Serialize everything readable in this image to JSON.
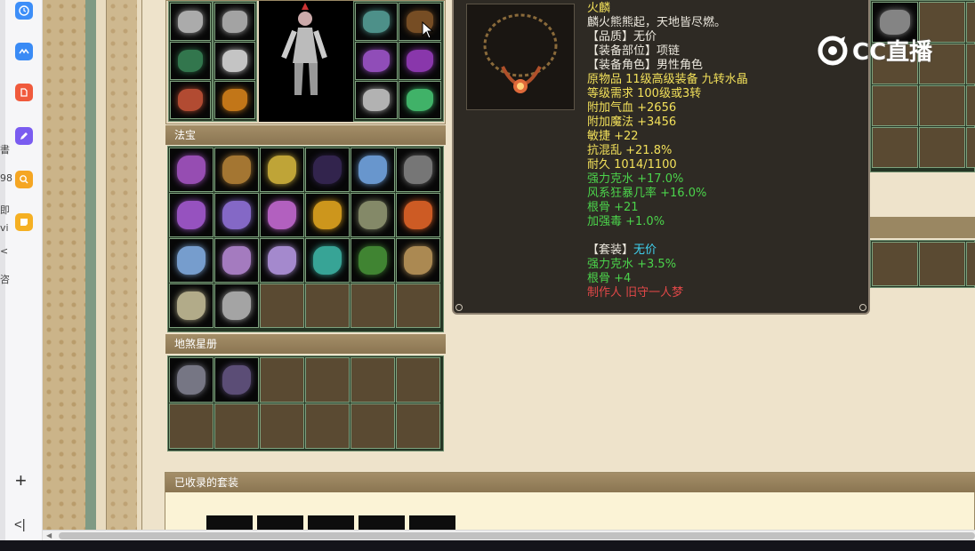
{
  "dock": {
    "apps": [
      {
        "icon": "clock-icon",
        "color": "#3d8ef8"
      },
      {
        "icon": "wave-icon",
        "color": "#3a8bf5"
      },
      {
        "icon": "document-icon",
        "color": "#f05a3c"
      },
      {
        "icon": "pencil-icon",
        "color": "#7a5cf0"
      },
      {
        "icon": "search-icon",
        "color": "#f5a623"
      },
      {
        "icon": "note-icon",
        "color": "#f5b023"
      }
    ],
    "peek_texts": [
      "書",
      "98",
      "即",
      "vi",
      "<",
      "咨"
    ],
    "add_label": "+",
    "collapse_label": "<|"
  },
  "sections": {
    "fabao_title": "法宝",
    "disha_title": "地煞星册",
    "suits_title": "已收录的套装"
  },
  "tooltip": {
    "item_name": "火麟",
    "flavor": "麟火熊熊起，天地皆尽燃。",
    "quality_label": "【品质】",
    "quality_value": "无价",
    "slot_line": "【装备部位】项链",
    "role_line": "【装备角色】男性角色",
    "origin_line": "原物品 11级高级装备 九转水晶",
    "level_line": "等级需求 100级或3转",
    "hp_line": "附加气血 +2656",
    "mp_line": "附加魔法 +3456",
    "agility_line": "敏捷 +22",
    "chaos_line": "抗混乱 +21.8%",
    "durability_line": "耐久 1014/1100",
    "green_lines": [
      "强力克水 +17.0%",
      "风系狂暴几率 +16.0%",
      "根骨 +21",
      "加强毒 +1.0%"
    ],
    "set_label": "【套装】",
    "set_value": "无价",
    "set_bonus_lines": [
      "强力克水 +3.5%",
      "根骨 +4"
    ],
    "maker_line": "制作人 旧守一人梦"
  },
  "watermark": {
    "text": "CC直播"
  },
  "colors": {
    "slot_empty": "#5a4a32",
    "slot_border": "#7ea27e",
    "section_header": "#8a7552",
    "tooltip_bg": "#2e2a24"
  }
}
